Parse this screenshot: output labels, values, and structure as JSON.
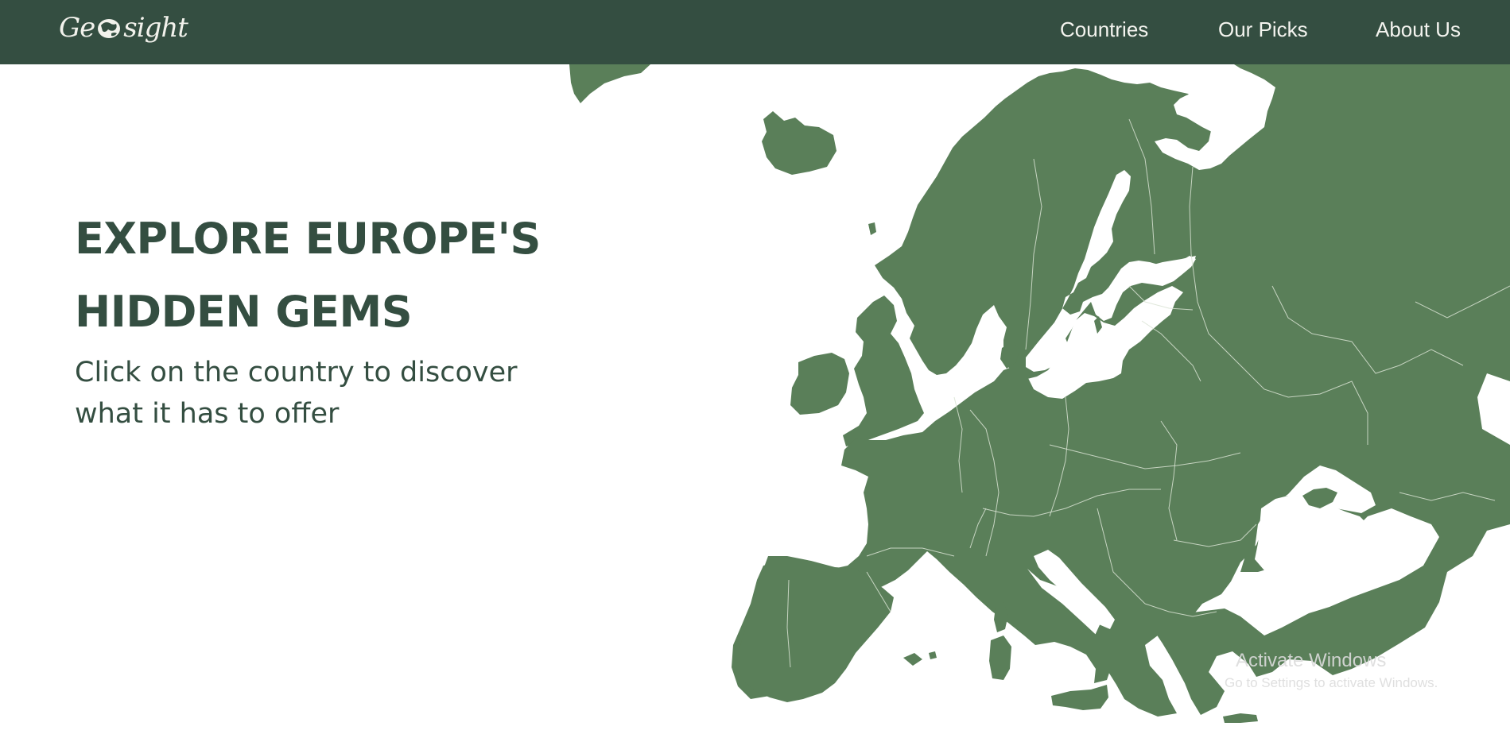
{
  "app": {
    "logo_text_left": "Ge",
    "logo_text_right": "sight"
  },
  "nav": {
    "links": [
      "Countries",
      "Our Picks",
      "About Us"
    ]
  },
  "hero": {
    "title_line1": "EXPLORE EUROPE'S",
    "title_line2": "HIDDEN GEMS",
    "subtitle": "Click on the country to discover what it has to offer"
  },
  "map": {
    "region": "Europe",
    "land_color": "#5a7f59",
    "border_color": "#d9e3d4"
  },
  "watermark": {
    "title": "Activate Windows",
    "subtitle": "Go to Settings to activate Windows."
  },
  "colors": {
    "navbar": "#344e41",
    "heading": "#344e41",
    "background": "#ffffff"
  },
  "icons": [
    "globe-logo-icon"
  ]
}
